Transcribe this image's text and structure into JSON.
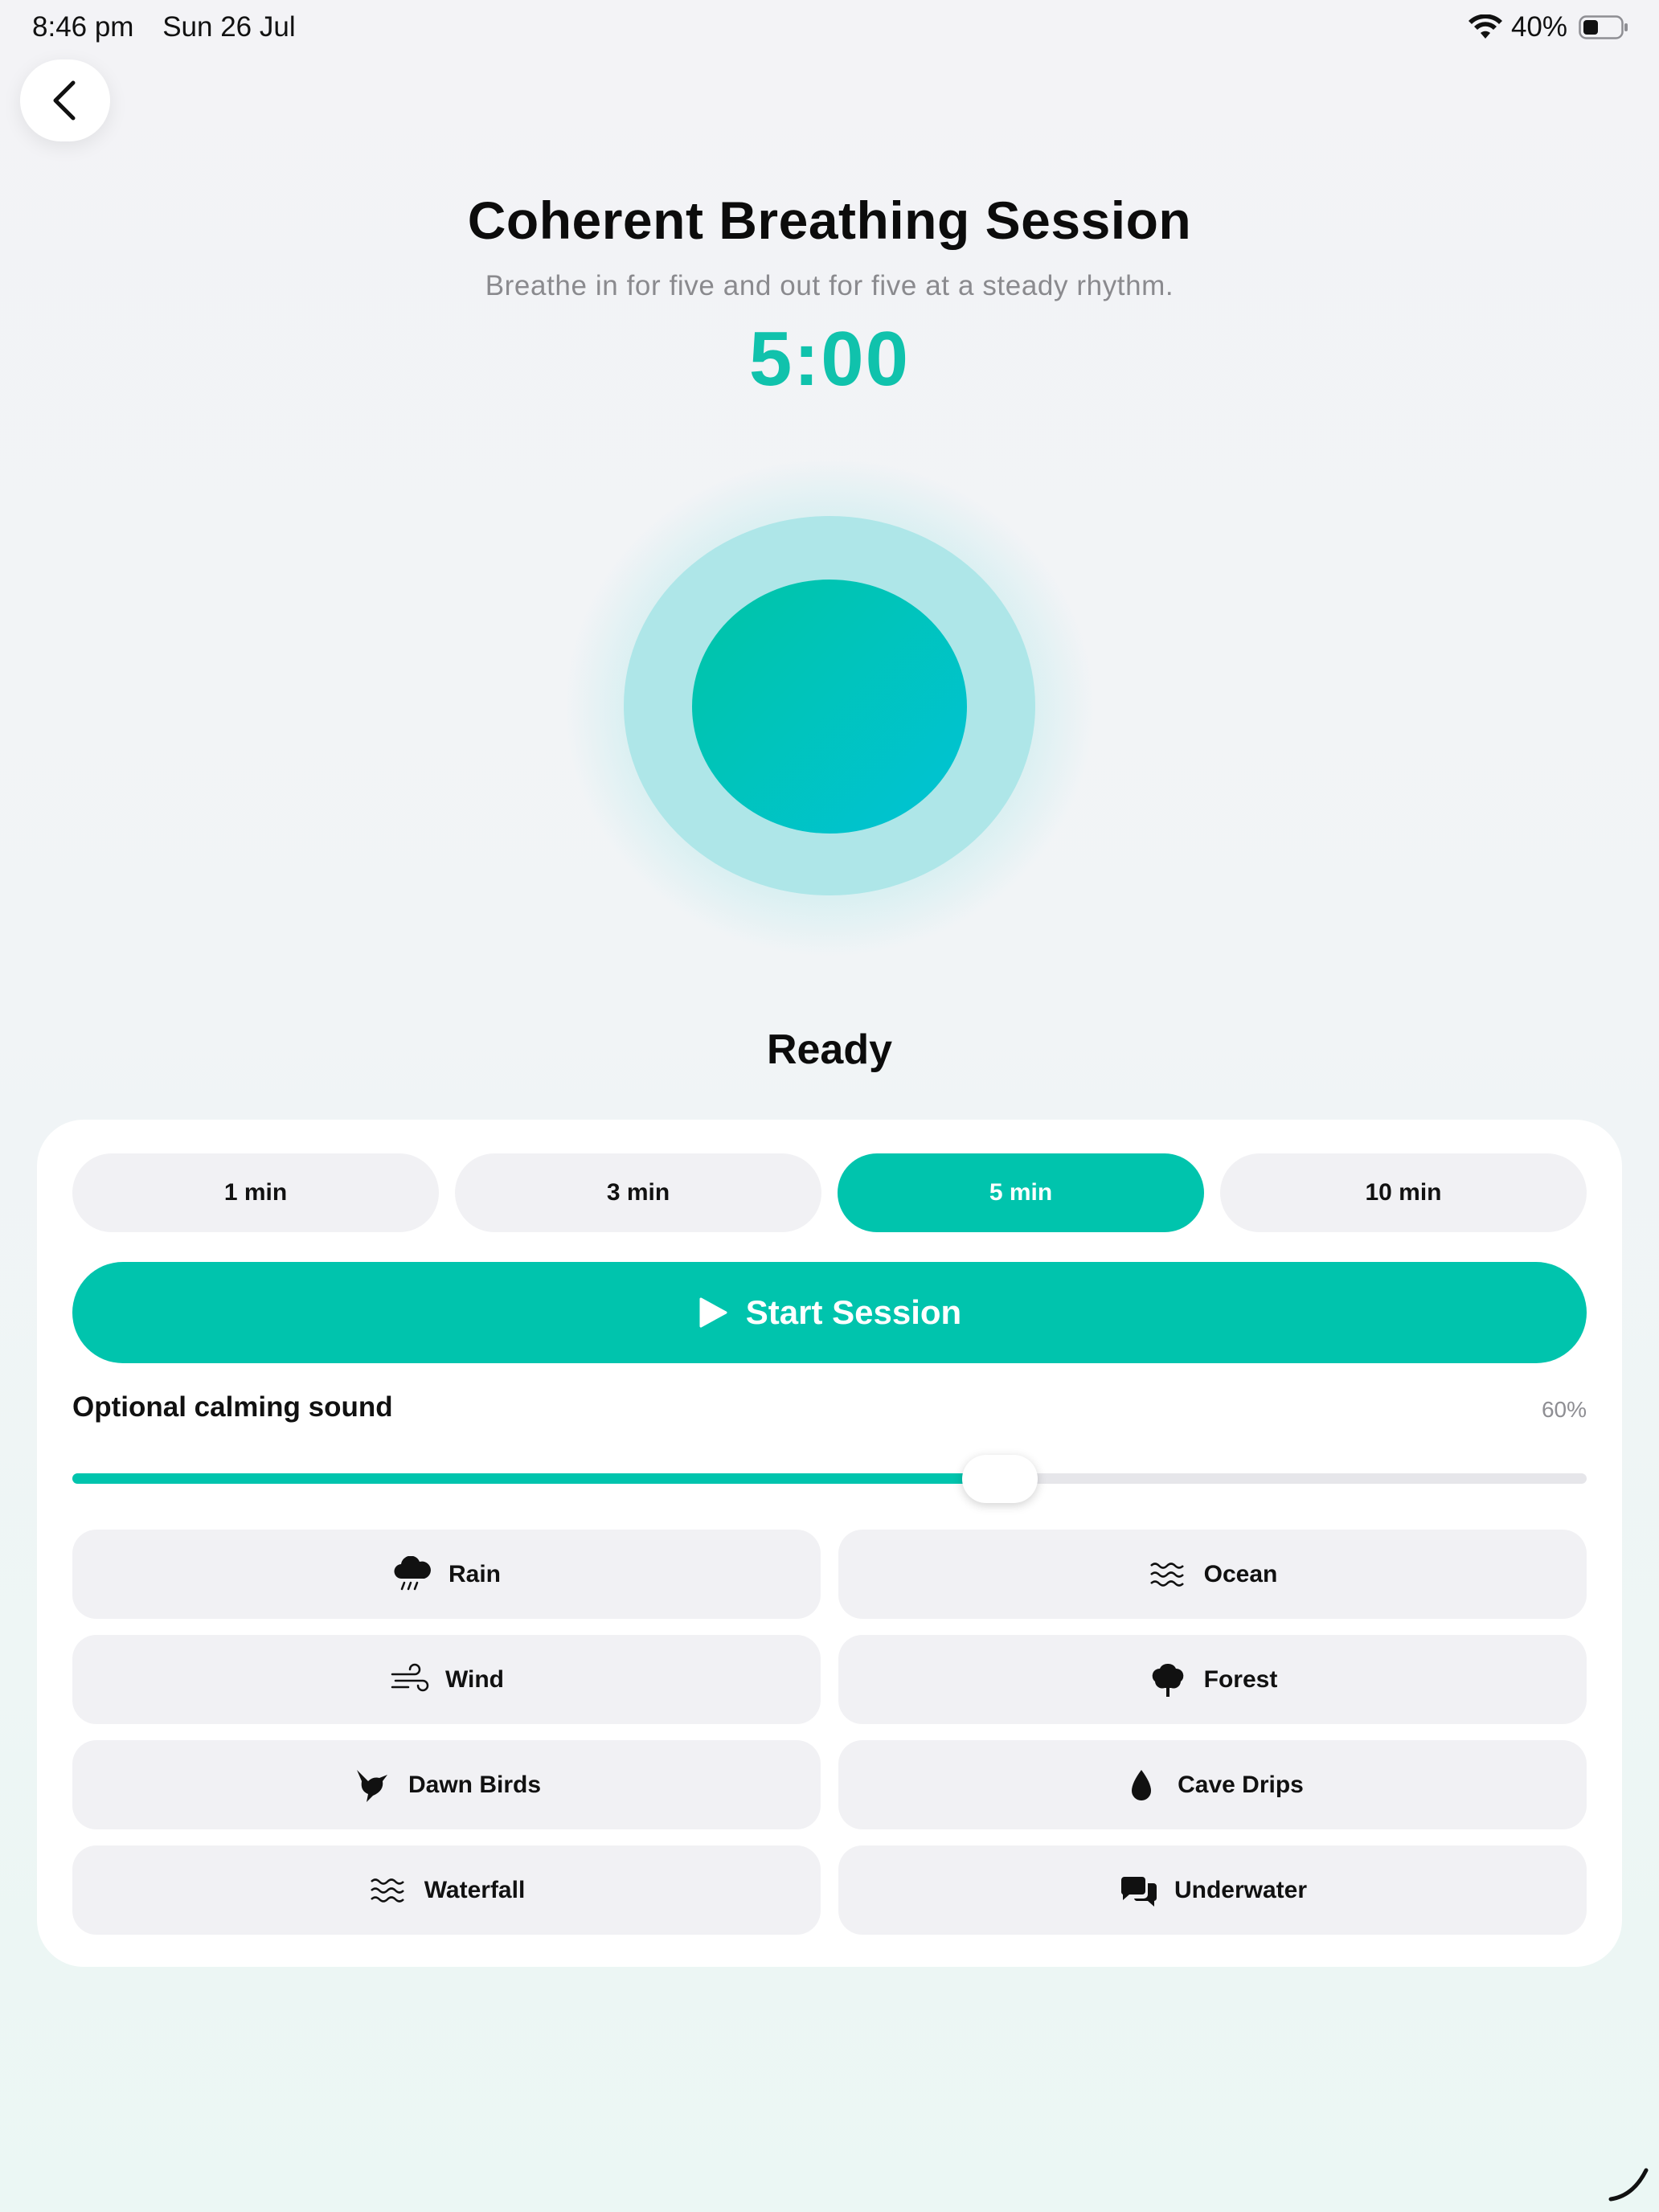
{
  "status_bar": {
    "time": "8:46 pm",
    "date": "Sun 26 Jul",
    "battery": "40%"
  },
  "header": {
    "title": "Coherent Breathing Session",
    "subtitle": "Breathe in for five and out for five at a steady rhythm.",
    "timer": "5:00"
  },
  "phase": "Ready",
  "durations": [
    {
      "label": "1 min",
      "selected": false
    },
    {
      "label": "3 min",
      "selected": false
    },
    {
      "label": "5 min",
      "selected": true
    },
    {
      "label": "10 min",
      "selected": false
    }
  ],
  "start_button": {
    "label": "Start Session",
    "icon": "play-icon"
  },
  "sound": {
    "label": "Optional calming sound",
    "volume_text": "60%",
    "volume": 0.6,
    "options": [
      {
        "label": "Rain",
        "icon": "rain-cloud-icon"
      },
      {
        "label": "Ocean",
        "icon": "waves-icon"
      },
      {
        "label": "Wind",
        "icon": "wind-icon"
      },
      {
        "label": "Forest",
        "icon": "tree-icon"
      },
      {
        "label": "Dawn Birds",
        "icon": "bird-icon"
      },
      {
        "label": "Cave Drips",
        "icon": "drop-icon"
      },
      {
        "label": "Waterfall",
        "icon": "waves-icon"
      },
      {
        "label": "Underwater",
        "icon": "speech-bubbles-icon"
      }
    ]
  },
  "colors": {
    "accent": "#00c4ad",
    "timer": "#10c2ac",
    "chip_bg": "#f1f1f4"
  }
}
